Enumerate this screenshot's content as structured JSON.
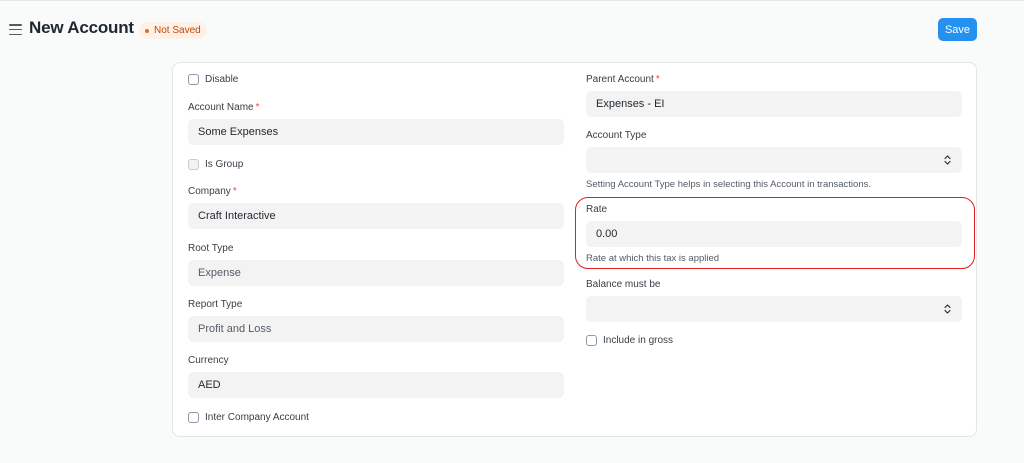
{
  "header": {
    "title": "New Account",
    "status": "Not Saved",
    "save_label": "Save"
  },
  "form": {
    "left": {
      "disable_label": "Disable",
      "account_name": {
        "label": "Account Name",
        "value": "Some Expenses"
      },
      "is_group_label": "Is Group",
      "company": {
        "label": "Company",
        "value": "Craft Interactive"
      },
      "root_type": {
        "label": "Root Type",
        "value": "Expense"
      },
      "report_type": {
        "label": "Report Type",
        "value": "Profit and Loss"
      },
      "currency": {
        "label": "Currency",
        "value": "AED"
      },
      "inter_company_label": "Inter Company Account"
    },
    "right": {
      "parent_account": {
        "label": "Parent Account",
        "value": "Expenses - EI"
      },
      "account_type": {
        "label": "Account Type",
        "value": "",
        "help": "Setting Account Type helps in selecting this Account in transactions."
      },
      "rate": {
        "label": "Rate",
        "value": "0.00",
        "help": "Rate at which this tax is applied"
      },
      "balance_must_be": {
        "label": "Balance must be",
        "value": ""
      },
      "include_in_gross_label": "Include in gross"
    }
  },
  "colors": {
    "primary": "#2490ef",
    "status_bg": "#fff1e7",
    "status_text": "#c34900",
    "highlight": "#e02020",
    "required": "#e24c4c"
  }
}
